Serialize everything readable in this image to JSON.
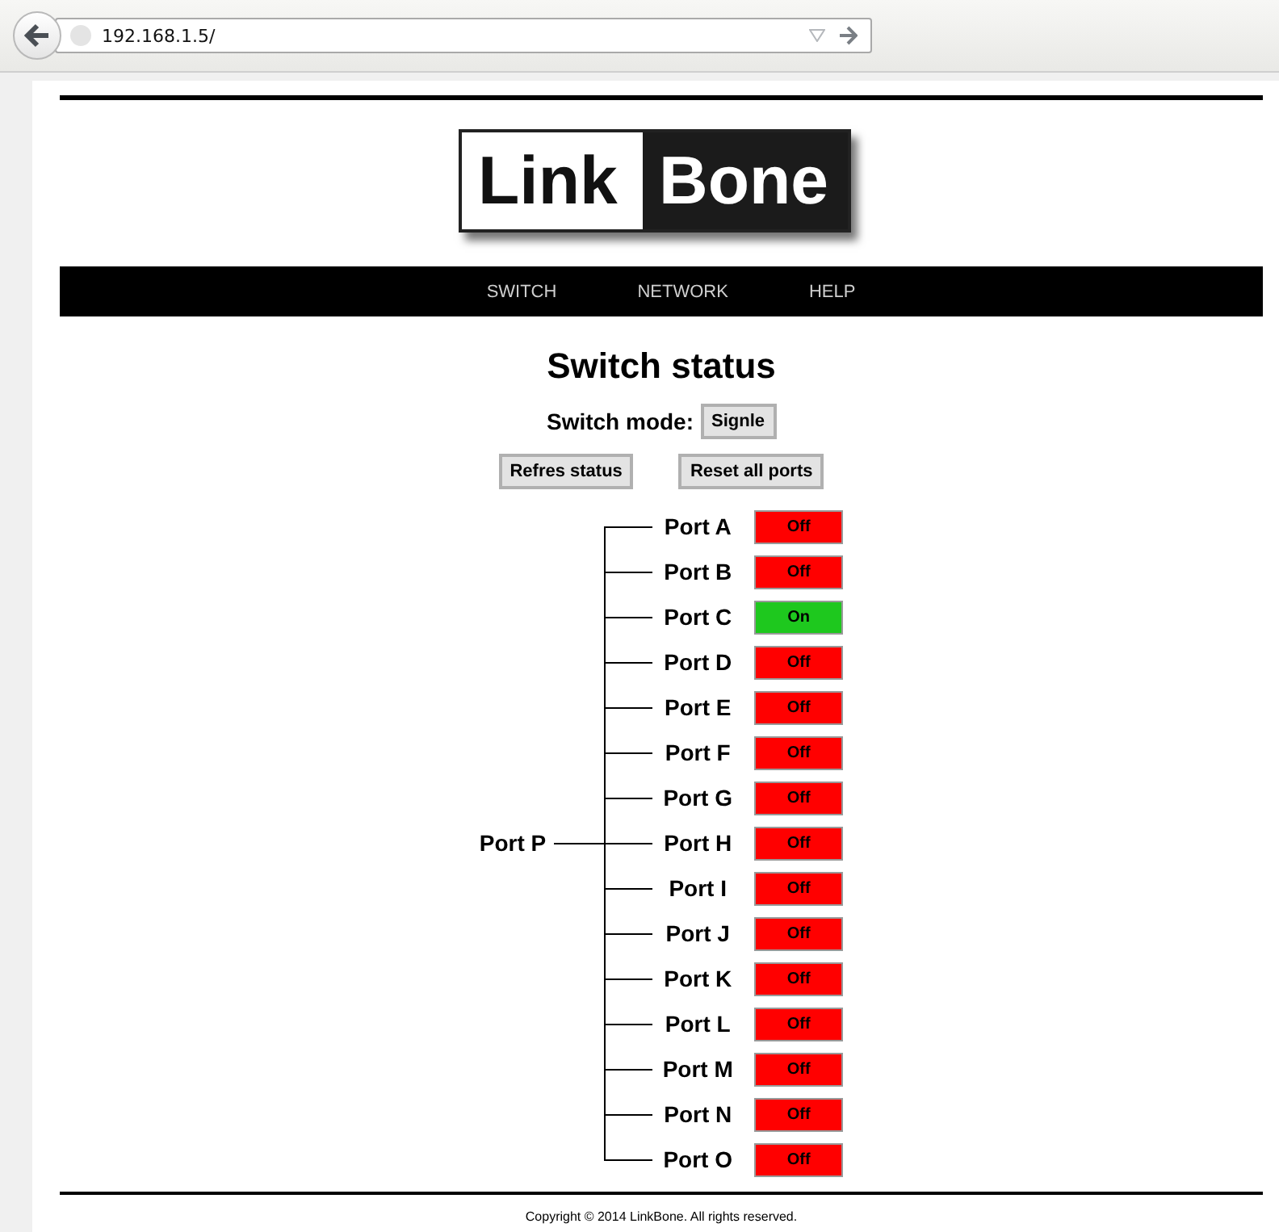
{
  "browser": {
    "address": "192.168.1.5/"
  },
  "logo": {
    "left": "Link",
    "right": "Bone"
  },
  "nav": [
    {
      "label": "SWITCH"
    },
    {
      "label": "NETWORK"
    },
    {
      "label": "HELP"
    }
  ],
  "title": "Switch status",
  "mode": {
    "label": "Switch mode:",
    "value": "Signle"
  },
  "actions": [
    "Refres status",
    "Reset all ports"
  ],
  "source_port": "Port P",
  "ports": [
    {
      "name": "Port A",
      "on": false,
      "status": "Off"
    },
    {
      "name": "Port B",
      "on": false,
      "status": "Off"
    },
    {
      "name": "Port C",
      "on": true,
      "status": "On"
    },
    {
      "name": "Port D",
      "on": false,
      "status": "Off"
    },
    {
      "name": "Port E",
      "on": false,
      "status": "Off"
    },
    {
      "name": "Port F",
      "on": false,
      "status": "Off"
    },
    {
      "name": "Port G",
      "on": false,
      "status": "Off"
    },
    {
      "name": "Port H",
      "on": false,
      "status": "Off"
    },
    {
      "name": "Port I",
      "on": false,
      "status": "Off"
    },
    {
      "name": "Port J",
      "on": false,
      "status": "Off"
    },
    {
      "name": "Port K",
      "on": false,
      "status": "Off"
    },
    {
      "name": "Port L",
      "on": false,
      "status": "Off"
    },
    {
      "name": "Port M",
      "on": false,
      "status": "Off"
    },
    {
      "name": "Port N",
      "on": false,
      "status": "Off"
    },
    {
      "name": "Port O",
      "on": false,
      "status": "Off"
    }
  ],
  "footer": "Copyright © 2014 LinkBone. All rights reserved."
}
